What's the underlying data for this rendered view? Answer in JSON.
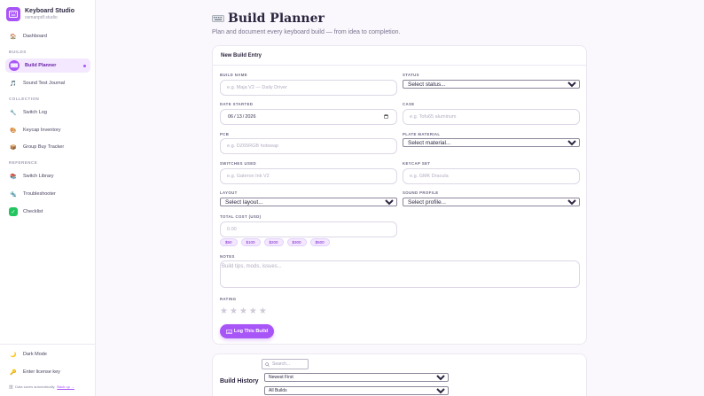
{
  "brand": {
    "name": "Keyboard Studio",
    "subtitle": "osmanpdf.studio"
  },
  "nav": {
    "dashboard": "Dashboard",
    "section_builds": "BUILDS",
    "build_planner": "Build Planner",
    "sound_test": "Sound Test Journal",
    "section_collection": "COLLECTION",
    "switch_log": "Switch Log",
    "keycap_inventory": "Keycap Inventory",
    "group_buy": "Group Buy Tracker",
    "section_reference": "REFERENCE",
    "switch_library": "Switch Library",
    "troubleshooter": "Troubleshooter",
    "checklist": "Checklist"
  },
  "footer": {
    "dark_mode": "Dark Mode",
    "license": "Enter license key",
    "note": "Data saves automatically.",
    "backup": "Back up →"
  },
  "page": {
    "title": "Build Planner",
    "subtitle": "Plan and document every keyboard build — from idea to completion."
  },
  "form": {
    "card_title": "New Build Entry",
    "build_name": {
      "label": "BUILD NAME",
      "placeholder": "e.g. Maja V2 — Daily Driver"
    },
    "status": {
      "label": "STATUS",
      "value": "Select status..."
    },
    "date_started": {
      "label": "DATE STARTED",
      "value": "2026-06-13"
    },
    "case": {
      "label": "CASE",
      "placeholder": "e.g. Tofu65 aluminum"
    },
    "pcb": {
      "label": "PCB",
      "placeholder": "e.g. DZ65RGB hotswap"
    },
    "plate": {
      "label": "PLATE MATERIAL",
      "value": "Select material..."
    },
    "switches": {
      "label": "SWITCHES USED",
      "placeholder": "e.g. Gateron Ink V2"
    },
    "keycaps": {
      "label": "KEYCAP SET",
      "placeholder": "e.g. GMK Dracula"
    },
    "layout": {
      "label": "LAYOUT",
      "value": "Select layout..."
    },
    "sound": {
      "label": "SOUND PROFILE",
      "value": "Select profile..."
    },
    "cost": {
      "label": "TOTAL COST (USD)",
      "placeholder": "0.00"
    },
    "cost_chips": [
      "$50",
      "$100",
      "$200",
      "$300",
      "$500"
    ],
    "notes": {
      "label": "NOTES",
      "placeholder": "Build tips, mods, issues..."
    },
    "rating": {
      "label": "RATING",
      "stars": 5,
      "value": 0
    },
    "submit": "Log This Build"
  },
  "history": {
    "title": "Build History",
    "search_placeholder": "Search...",
    "sort": "Newest First",
    "filter": "All Builds"
  },
  "colors": {
    "accent": "#a855f7",
    "accent_soft": "#f3e8ff"
  }
}
